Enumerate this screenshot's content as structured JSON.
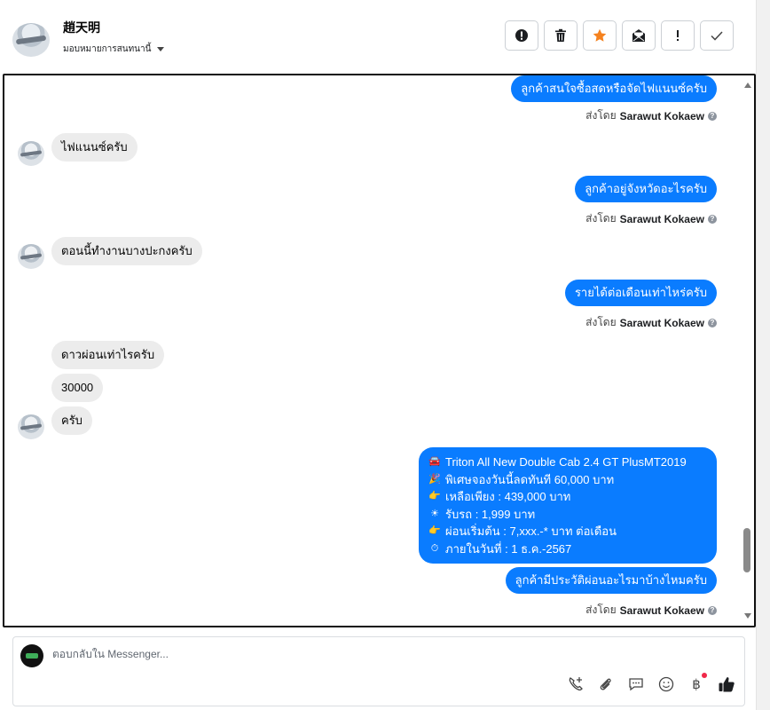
{
  "header": {
    "contact_name": "趙天明",
    "assign_label": "มอบหมายการสนทนานี้"
  },
  "actions": [
    {
      "name": "report-spam-button",
      "icon": "alert-circle-icon"
    },
    {
      "name": "delete-button",
      "icon": "trash-icon"
    },
    {
      "name": "star-button",
      "icon": "star-icon",
      "color": "#f5821f"
    },
    {
      "name": "mark-unread-button",
      "icon": "envelope-open-icon"
    },
    {
      "name": "important-button",
      "icon": "exclamation-icon"
    },
    {
      "name": "mark-done-button",
      "icon": "check-icon"
    }
  ],
  "conversation": {
    "messages": [
      {
        "side": "out",
        "text": "ลูกค้าสนใจซื้อสดหรือจัดไฟแนนซ์ครับ"
      },
      {
        "side": "in",
        "text": "ไฟแนนซ์ครับ"
      },
      {
        "side": "out",
        "text": "ลูกค้าอยู่จังหวัดอะไรครับ"
      },
      {
        "side": "in",
        "text": "ตอนนี้ทำงานบางปะกงครับ"
      },
      {
        "side": "out",
        "text": "รายได้ต่อเดือนเท่าไหร่ครับ"
      },
      {
        "side": "in",
        "text": "ดาวผ่อนเท่าไรครับ"
      },
      {
        "side": "in",
        "text": "30000"
      },
      {
        "side": "in",
        "text": "ครับ"
      },
      {
        "side": "out",
        "text": "ลูกค้ามีประวัติผ่อนอะไรมาบ้างไหมครับ"
      }
    ],
    "sent_by_prefix": "ส่งโดย",
    "sent_by_name": "Sarawut Kokaew",
    "promo": [
      {
        "emoji": "🚘",
        "text": "Triton All New Double Cab 2.4 GT PlusMT2019"
      },
      {
        "emoji": "🎉",
        "text": "พิเศษจองวันนี้ลดทันที 60,000 บาท"
      },
      {
        "emoji": "👉",
        "text": "เหลือเพียง : 439,000 บาท"
      },
      {
        "emoji": "☀",
        "text": "รับรถ : 1,999 บาท"
      },
      {
        "emoji": "👉",
        "text": "ผ่อนเริ่มต้น : 7,xxx.-* บาท ต่อเดือน"
      },
      {
        "emoji": "⏱",
        "text": "ภายในวันที่ : 1 ธ.ค.-2567"
      }
    ]
  },
  "composer": {
    "placeholder": "ตอบกลับใน Messenger..."
  },
  "colors": {
    "outgoing_bubble": "#0a7cff",
    "incoming_bubble": "#ececec",
    "star": "#f5821f"
  }
}
